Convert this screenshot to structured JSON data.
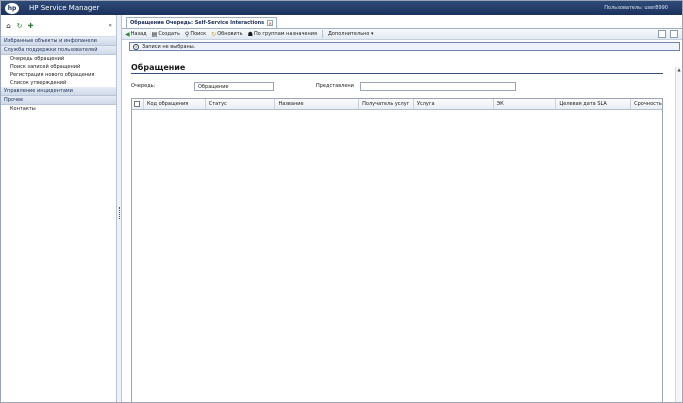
{
  "app": {
    "logo": "hp",
    "title": "HP Service Manager",
    "user_label": "Пользователь: user8990"
  },
  "sidebar": {
    "tools": [
      "home-icon",
      "refresh-icon",
      "favorites-icon"
    ],
    "collapse": "«",
    "sections": [
      {
        "label": "Избранные объекты и инфопанели",
        "items": []
      },
      {
        "label": "Служба поддержки пользователей",
        "items": [
          "Очередь обращений",
          "Поиск записей обращений",
          "Регистрация нового обращения",
          "Список утверждений"
        ]
      },
      {
        "label": "Управление инцидентами",
        "items": []
      },
      {
        "label": "Прочее",
        "items": [
          "Контакты"
        ]
      }
    ]
  },
  "tab": {
    "label": "Обращение Очередь: Self-Service Interactions",
    "close": "×"
  },
  "toolbar": {
    "back": "Назад",
    "create": "Создать",
    "search": "Поиск",
    "refresh": "Обновить",
    "by_groups": "По группам назначения",
    "more": "Дополнительно ▾"
  },
  "message": {
    "text": "Записи не выбраны."
  },
  "form": {
    "section_title": "Обращение",
    "queue_label": "Очередь:",
    "queue_value": "Обращение",
    "view_label": "Представлени",
    "view_value": ""
  },
  "grid": {
    "columns": [
      "Код обращения",
      "Статус",
      "Название",
      "Получатель услуг",
      "Услуга",
      "ЭК",
      "Целевая дата SLA",
      "Срочность"
    ],
    "rows": []
  },
  "colors": {
    "topbar": "#1c325d",
    "accent": "#34507e"
  }
}
